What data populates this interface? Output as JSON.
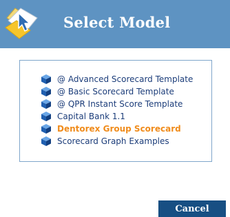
{
  "header": {
    "title": "Select Model",
    "background_color": "#5e93c2",
    "icon": "model-cursor-icon"
  },
  "model_list": {
    "items": [
      {
        "label": "@ Advanced Scorecard Template",
        "icon": "model-cube-icon",
        "selected": false
      },
      {
        "label": "@ Basic Scorecard Template",
        "icon": "model-cube-icon",
        "selected": false
      },
      {
        "label": "@ QPR Instant Score Template",
        "icon": "model-cube-icon",
        "selected": false
      },
      {
        "label": "Capital Bank 1.1",
        "icon": "model-cube-icon",
        "selected": false
      },
      {
        "label": "Dentorex Group Scorecard",
        "icon": "model-cube-icon",
        "selected": true
      },
      {
        "label": "Scorecard Graph Examples",
        "icon": "model-cube-icon",
        "selected": false
      }
    ],
    "item_color": "#1c3d7a",
    "selected_color": "#f08c1c",
    "border_color": "#7fa6cb"
  },
  "footer": {
    "cancel_label": "Cancel",
    "button_color": "#174f83"
  }
}
